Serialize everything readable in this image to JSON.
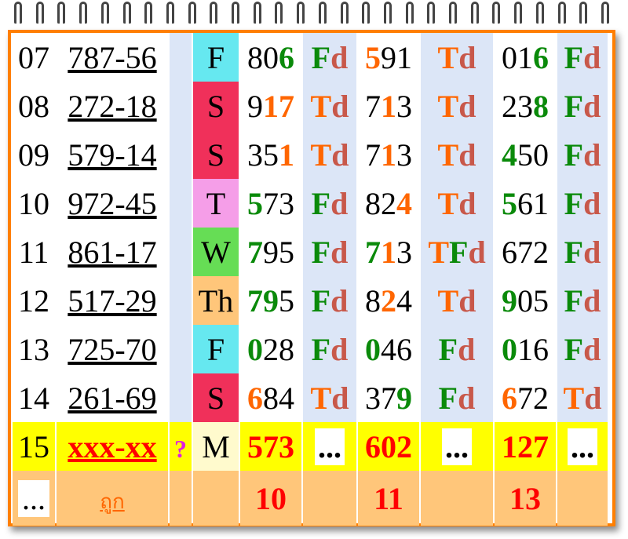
{
  "rows": [
    {
      "n": "07",
      "pair": "787-56",
      "day": "F",
      "dayColor": "#66e8f0",
      "a": [
        [
          "80",
          "k"
        ],
        [
          "6",
          "g"
        ]
      ],
      "b": "Fd",
      "c": [
        [
          "5",
          "o"
        ],
        [
          "91",
          "k"
        ]
      ],
      "d": "Td",
      "e": [
        [
          "01",
          "k"
        ],
        [
          "6",
          "g"
        ]
      ],
      "f": "Fd"
    },
    {
      "n": "08",
      "pair": "272-18",
      "day": "S",
      "dayColor": "#f0305a",
      "a": [
        [
          "9",
          "k"
        ],
        [
          "17",
          "o"
        ]
      ],
      "b": "Td",
      "c": [
        [
          "7",
          "k"
        ],
        [
          "1",
          "o"
        ],
        [
          "3",
          "k"
        ]
      ],
      "d": "Td",
      "e": [
        [
          "23",
          "k"
        ],
        [
          "8",
          "g"
        ]
      ],
      "f": "Fd"
    },
    {
      "n": "09",
      "pair": "579-14",
      "day": "S",
      "dayColor": "#f0305a",
      "a": [
        [
          "35",
          "k"
        ],
        [
          "1",
          "o"
        ]
      ],
      "b": "Td",
      "c": [
        [
          "7",
          "k"
        ],
        [
          "1",
          "o"
        ],
        [
          "3",
          "k"
        ]
      ],
      "d": "Td",
      "e": [
        [
          "4",
          "g"
        ],
        [
          "50",
          "k"
        ]
      ],
      "f": "Fd"
    },
    {
      "n": "10",
      "pair": "972-45",
      "day": "T",
      "dayColor": "#f59ee8",
      "a": [
        [
          "5",
          "g"
        ],
        [
          "73",
          "k"
        ]
      ],
      "b": "Fd",
      "c": [
        [
          "82",
          "k"
        ],
        [
          "4",
          "o"
        ]
      ],
      "d": "Td",
      "e": [
        [
          "5",
          "g"
        ],
        [
          "61",
          "k"
        ]
      ],
      "f": "Fd"
    },
    {
      "n": "11",
      "pair": "861-17",
      "day": "W",
      "dayColor": "#66dd55",
      "a": [
        [
          "7",
          "g"
        ],
        [
          "95",
          "k"
        ]
      ],
      "b": "Fd",
      "c": [
        [
          "7",
          "g"
        ],
        [
          "1",
          "o"
        ],
        [
          "3",
          "k"
        ]
      ],
      "d": "TFd",
      "e": [
        [
          "672",
          "k"
        ]
      ],
      "f": "Fd"
    },
    {
      "n": "12",
      "pair": "517-29",
      "day": "Th",
      "dayColor": "#ffc67a",
      "a": [
        [
          "7",
          "g"
        ],
        [
          "9",
          "g"
        ],
        [
          "5",
          "k"
        ]
      ],
      "b": "Fd",
      "c": [
        [
          "8",
          "k"
        ],
        [
          "2",
          "o"
        ],
        [
          "4",
          "k"
        ]
      ],
      "d": "Td",
      "e": [
        [
          "9",
          "g"
        ],
        [
          "05",
          "k"
        ]
      ],
      "f": "Fd"
    },
    {
      "n": "13",
      "pair": "725-70",
      "day": "F",
      "dayColor": "#66e8f0",
      "a": [
        [
          "0",
          "g"
        ],
        [
          "28",
          "k"
        ]
      ],
      "b": "Fd",
      "c": [
        [
          "0",
          "g"
        ],
        [
          "46",
          "k"
        ]
      ],
      "d": "Fd",
      "e": [
        [
          "0",
          "g"
        ],
        [
          "16",
          "k"
        ]
      ],
      "f": "Fd"
    },
    {
      "n": "14",
      "pair": "261-69",
      "day": "S",
      "dayColor": "#f0305a",
      "a": [
        [
          "6",
          "o"
        ],
        [
          "84",
          "k"
        ]
      ],
      "b": "Td",
      "c": [
        [
          "37",
          "k"
        ],
        [
          "9",
          "g"
        ]
      ],
      "d": "Fd",
      "e": [
        [
          "6",
          "o"
        ],
        [
          "72",
          "k"
        ]
      ],
      "f": "Td"
    }
  ],
  "current": {
    "n": "15",
    "pair": "xxx-xx",
    "q": "?",
    "day": "M",
    "a": "573",
    "b": "...",
    "c": "602",
    "d": "...",
    "e": "127",
    "f": "..."
  },
  "footer": {
    "box": "...",
    "label": "ถูก",
    "a": "10",
    "c": "11",
    "e": "13"
  }
}
